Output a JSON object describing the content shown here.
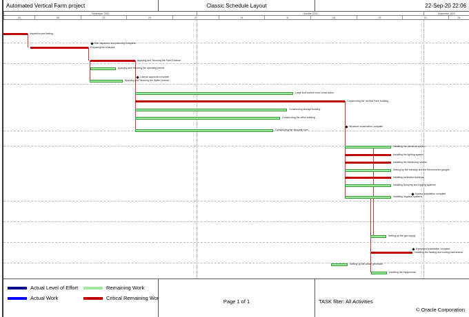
{
  "header": {
    "project": "Automated Vertical Farm project",
    "layout": "Classic Schedule Layout",
    "datetime": "22-Sep-20 22:06"
  },
  "timescale": {
    "months": [
      "September 2020",
      "October 2020",
      "November 2020"
    ],
    "weeks": [
      "30",
      "06",
      "13",
      "20",
      "27",
      "04",
      "11",
      "18",
      "25",
      "01",
      "08"
    ]
  },
  "activities": [
    {
      "label": "Inspection and testing",
      "type": "critical"
    },
    {
      "label": "Site inspection and planning Complete",
      "type": "milestone"
    },
    {
      "label": "Preparing the blueprint",
      "type": "critical"
    },
    {
      "label": "Applying and Securing the Farm License",
      "type": "critical"
    },
    {
      "label": "Applying and Securing the operating permit",
      "type": "remaining"
    },
    {
      "label": "License approval complete",
      "type": "milestone"
    },
    {
      "label": "Applying and Securing the Water License",
      "type": "remaining"
    },
    {
      "label": "Large and control room construction",
      "type": "remaining"
    },
    {
      "label": "Constructing the Vertical Farm building",
      "type": "critical"
    },
    {
      "label": "Constructing storage building",
      "type": "remaining"
    },
    {
      "label": "Constructing the office building",
      "type": "remaining"
    },
    {
      "label": "Structure construction complete",
      "type": "milestone"
    },
    {
      "label": "Constructing the disposal room",
      "type": "remaining"
    },
    {
      "label": "Installing the electrical system",
      "type": "remaining"
    },
    {
      "label": "Installing the lighting system",
      "type": "critical"
    },
    {
      "label": "Installing the Monitoring system",
      "type": "critical"
    },
    {
      "label": "Setting up the humidity and the thermometer gauges",
      "type": "remaining"
    },
    {
      "label": "Installing ventilation systems",
      "type": "critical"
    },
    {
      "label": "Installing Spraying and fogging systems",
      "type": "remaining"
    },
    {
      "label": "System installation complete",
      "type": "milestone"
    },
    {
      "label": "Installing Irrigation systems",
      "type": "remaining"
    },
    {
      "label": "Setting up the gas supply",
      "type": "remaining"
    },
    {
      "label": "Equipment installation complete",
      "type": "milestone"
    },
    {
      "label": "Installing the heating and cooling instruments",
      "type": "critical"
    },
    {
      "label": "Setting up the power generator",
      "type": "remaining"
    },
    {
      "label": "Installing the equipments",
      "type": "remaining"
    }
  ],
  "legend": [
    {
      "label": "Actual Level of Effort",
      "color": "#00008b"
    },
    {
      "label": "Actual Work",
      "color": "#0000ff"
    },
    {
      "label": "Remaining Work",
      "color": "#9fe89f"
    },
    {
      "label": "Critical Remaining Wor",
      "color": "#c00000"
    }
  ],
  "footer": {
    "page": "Page 1 of 1",
    "filter": "TASK filter: All Activities",
    "copyright": "© Oracle Corporation"
  }
}
